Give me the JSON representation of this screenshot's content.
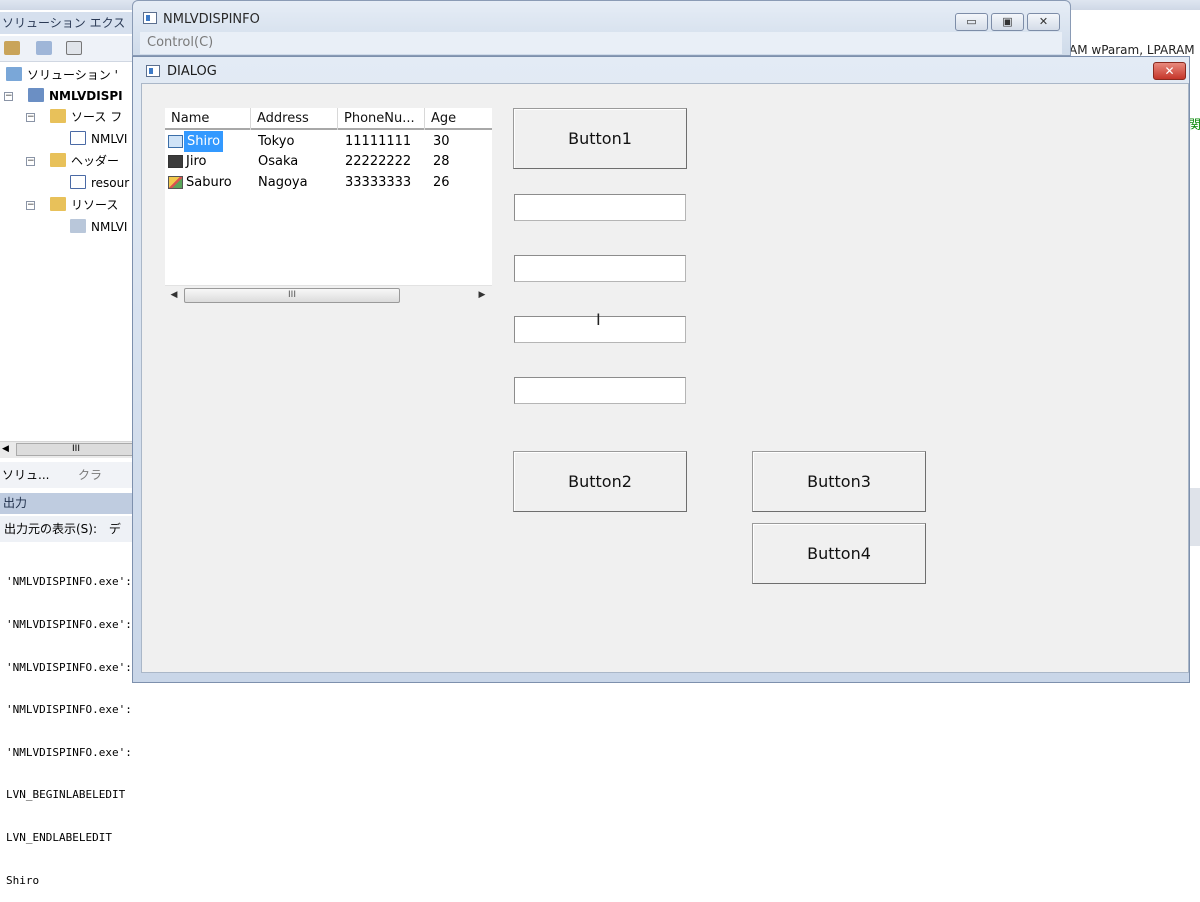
{
  "ide": {
    "solution_explorer_title": "ソリューション エクス",
    "tree": [
      {
        "label": "ソリューション '",
        "icon": "solution-icon"
      },
      {
        "label": "NMLVDISPI",
        "icon": "project-icon"
      },
      {
        "label": "ソース フ",
        "icon": "folder-icon"
      },
      {
        "label": "NMLVI",
        "icon": "cpp-file-icon"
      },
      {
        "label": "ヘッダー",
        "icon": "folder-icon"
      },
      {
        "label": "resour",
        "icon": "header-file-icon"
      },
      {
        "label": "リソース",
        "icon": "folder-icon"
      },
      {
        "label": "NMLVI",
        "icon": "resource-file-icon"
      }
    ],
    "scroll_grip": "III",
    "bottom_tabs": [
      "ソリュ...",
      "クラ"
    ],
    "output_title": "出力",
    "output_source_label": "出力元の表示(S):",
    "output_source_value": "デ",
    "output_lines": [
      "'NMLVDISPINFO.exe':",
      "'NMLVDISPINFO.exe':",
      "'NMLVDISPINFO.exe':",
      "'NMLVDISPINFO.exe':",
      "'NMLVDISPINFO.exe':",
      "LVN_BEGINLABELEDIT",
      "LVN_ENDLABELEDIT",
      "Shiro"
    ],
    "right_text": "AM wParam, LPARAM",
    "right_green_char": "関"
  },
  "parent_window": {
    "title": "NMLVDISPINFO",
    "menu": [
      "Control(C)"
    ],
    "caption_buttons": [
      "▭",
      "▣",
      "✕"
    ]
  },
  "dialog": {
    "title": "DIALOG",
    "close_glyph": "✕",
    "listview": {
      "columns": [
        "Name",
        "Address",
        "PhoneNu...",
        "Age"
      ],
      "rows": [
        {
          "name": "Shiro",
          "address": "Tokyo",
          "phone": "11111111",
          "age": "30",
          "icon": "edit-pencil-icon",
          "selected": true
        },
        {
          "name": "Jiro",
          "address": "Osaka",
          "phone": "22222222",
          "age": "28",
          "icon": "monitor-icon",
          "selected": false
        },
        {
          "name": "Saburo",
          "address": "Nagoya",
          "phone": "33333333",
          "age": "26",
          "icon": "pencil-icon",
          "selected": false
        }
      ],
      "scroll_left": "◀",
      "scroll_right": "▶",
      "scroll_grip": "III"
    },
    "buttons": {
      "button1": "Button1",
      "button2": "Button2",
      "button3": "Button3",
      "button4": "Button4"
    },
    "edits": [
      "",
      "",
      "",
      ""
    ],
    "cursor_glyph": "I"
  }
}
